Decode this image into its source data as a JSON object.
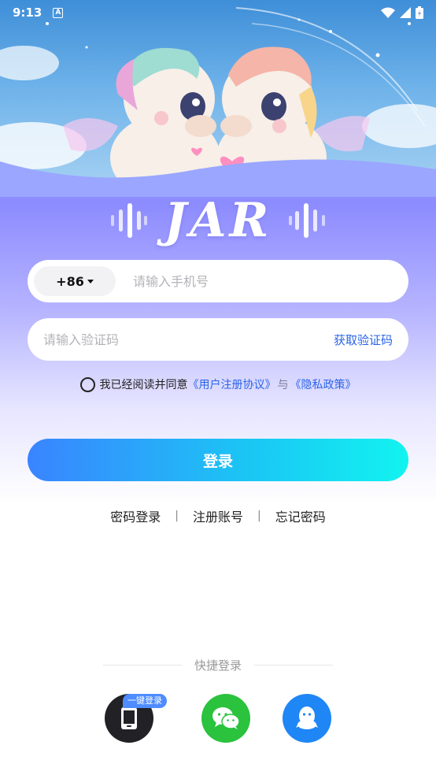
{
  "status_bar": {
    "time": "9:13",
    "notification_letter": "A"
  },
  "logo": {
    "text": "JAR"
  },
  "phone_field": {
    "country_code": "+86",
    "placeholder": "请输入手机号",
    "value": ""
  },
  "code_field": {
    "placeholder": "请输入验证码",
    "value": "",
    "get_code_label": "获取验证码"
  },
  "agreement": {
    "checked": false,
    "prefix": "我已经阅读并同意",
    "user_agreement": "《用户注册协议》",
    "and": "与",
    "privacy_policy": "《隐私政策》"
  },
  "login_button": {
    "label": "登录"
  },
  "sub_links": {
    "password_login": "密码登录",
    "register": "注册账号",
    "forgot": "忘记密码",
    "separator": "|"
  },
  "quick_login": {
    "title": "快捷登录",
    "one_tap_badge": "一键登录"
  },
  "colors": {
    "accent_blue": "#2a64e8",
    "wechat_green": "#2bc23e",
    "qq_blue": "#1f86f5"
  }
}
